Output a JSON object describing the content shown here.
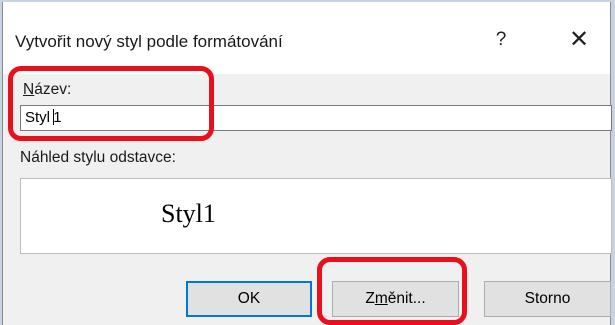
{
  "dialog": {
    "title": "Vytvořit nový styl podle formátování",
    "help_label": "?",
    "close_label": "✕"
  },
  "name_field": {
    "label_accel": "N",
    "label_rest": "ázev:",
    "value_before_caret": "Styl ",
    "value_after_caret": "1"
  },
  "preview": {
    "label": "Náhled stylu odstavce:",
    "text": "Styl1"
  },
  "buttons": {
    "ok": "OK",
    "change_before": "Z",
    "change_accel": "m",
    "change_after": "ěnit...",
    "cancel": "Storno"
  },
  "highlight_color": "#e8101c",
  "focus_color": "#0078d7"
}
